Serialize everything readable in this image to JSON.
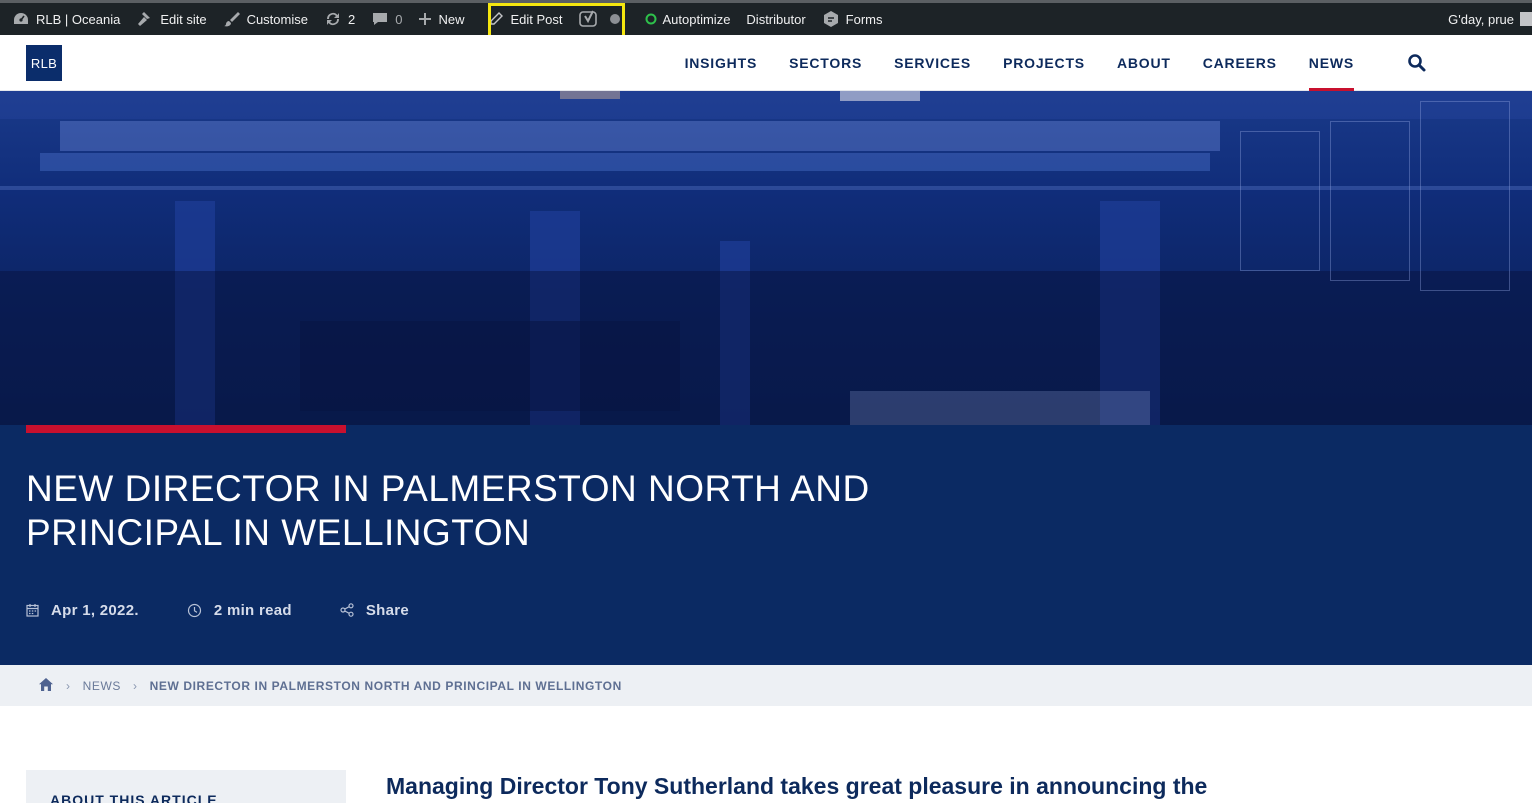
{
  "admin_bar": {
    "site_name": "RLB | Oceania",
    "edit_site": "Edit site",
    "customise": "Customise",
    "updates_count": "2",
    "comments_count": "0",
    "new_label": "New",
    "edit_post": "Edit Post",
    "autoptimize": "Autoptimize",
    "distributor": "Distributor",
    "forms": "Forms",
    "greeting": "G'day, prue",
    "highlight_color": "#f5e60f",
    "autoptimize_status_color": "#2ec14b"
  },
  "header": {
    "logo_text": "RLB",
    "nav": [
      {
        "label": "INSIGHTS"
      },
      {
        "label": "SECTORS"
      },
      {
        "label": "SERVICES"
      },
      {
        "label": "PROJECTS"
      },
      {
        "label": "ABOUT"
      },
      {
        "label": "CAREERS"
      },
      {
        "label": "NEWS",
        "active": true
      }
    ],
    "brand_color": "#0b2d6b",
    "accent_color": "#c8102e"
  },
  "post": {
    "title_line1": "NEW DIRECTOR IN PALMERSTON NORTH AND",
    "title_line2": "PRINCIPAL IN WELLINGTON",
    "date": "Apr 1, 2022.",
    "read_time": "2 min read",
    "share": "Share"
  },
  "breadcrumb": {
    "section": "NEWS",
    "current": "NEW DIRECTOR IN PALMERSTON NORTH AND PRINCIPAL IN WELLINGTON"
  },
  "content": {
    "sidebar_title": "ABOUT THIS ARTICLE",
    "lede": "Managing Director Tony Sutherland takes great pleasure in announcing the"
  }
}
